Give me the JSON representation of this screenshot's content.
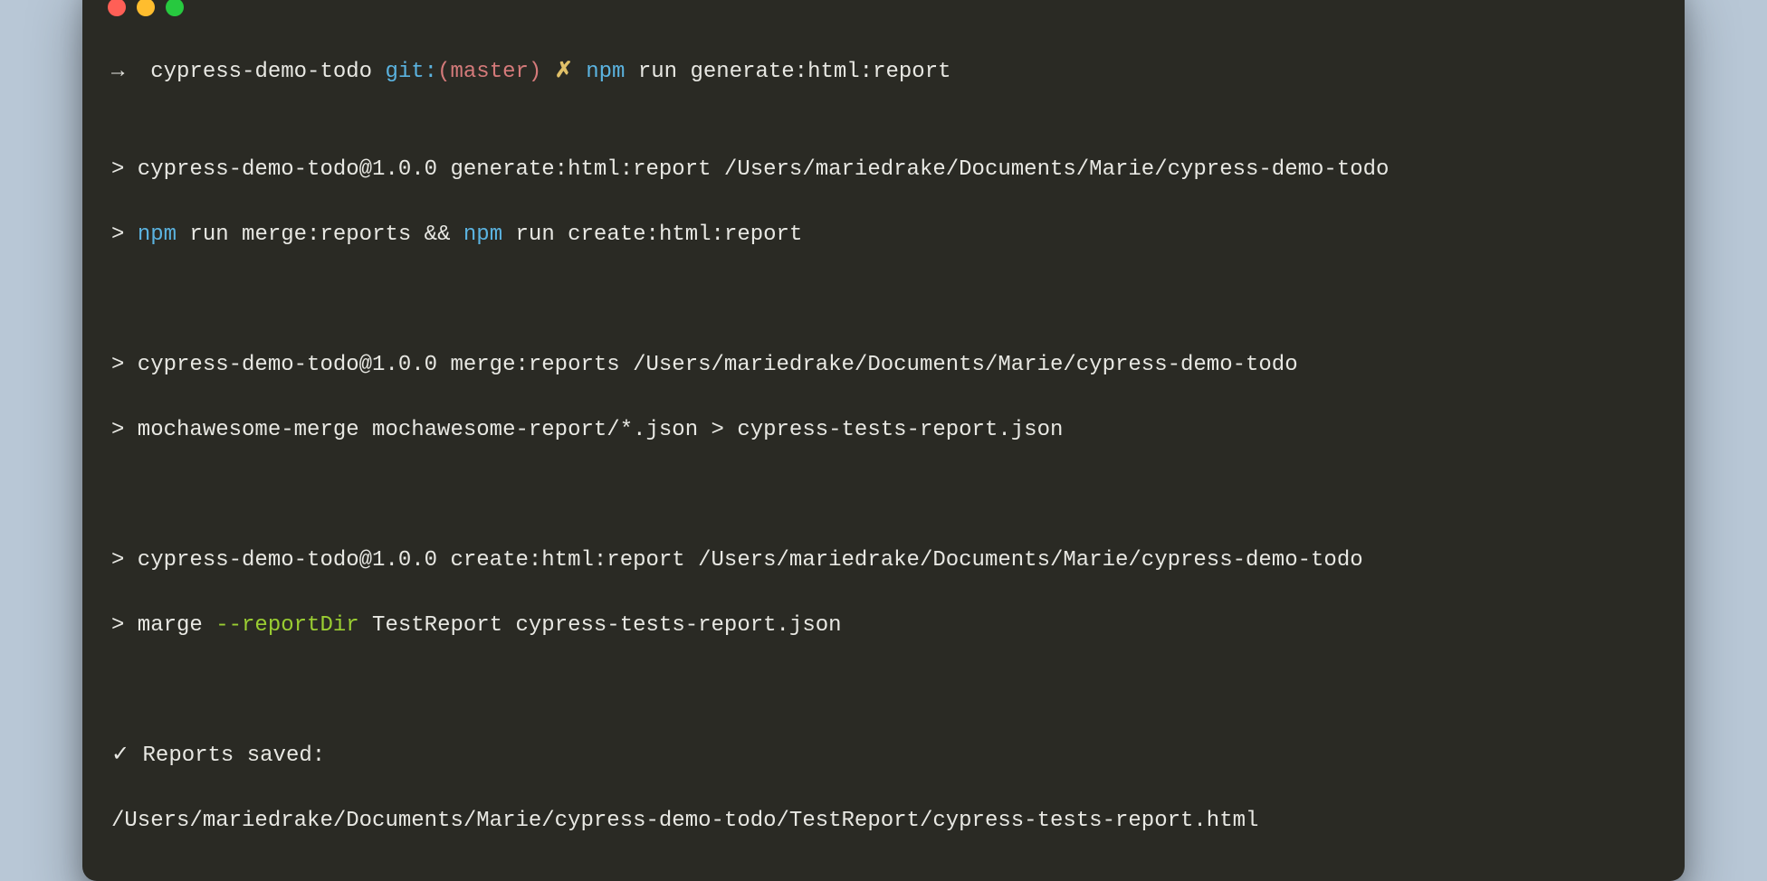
{
  "prompt": {
    "arrow": "→  ",
    "directory": "cypress-demo-todo ",
    "git_label": "git:",
    "git_branch": "(master) ",
    "dirty_marker": "✗",
    "space": " ",
    "command_npm": "npm",
    "command_rest": " run generate:html:report"
  },
  "block1": {
    "line1": "> cypress-demo-todo@1.0.0 generate:html:report /Users/mariedrake/Documents/Marie/cypress-demo-todo",
    "line2_prefix": "> ",
    "line2_npm1": "npm",
    "line2_mid1": " run merge:reports && ",
    "line2_npm2": "npm",
    "line2_rest": " run create:html:report"
  },
  "block2": {
    "line1": "> cypress-demo-todo@1.0.0 merge:reports /Users/mariedrake/Documents/Marie/cypress-demo-todo",
    "line2": "> mochawesome-merge mochawesome-report/*.json > cypress-tests-report.json"
  },
  "block3": {
    "line1": "> cypress-demo-todo@1.0.0 create:html:report /Users/mariedrake/Documents/Marie/cypress-demo-todo",
    "line2_prefix": "> marge ",
    "line2_flag": "--reportDir",
    "line2_rest": " TestReport cypress-tests-report.json"
  },
  "result": {
    "line1": "✓ Reports saved:",
    "line2": "/Users/mariedrake/Documents/Marie/cypress-demo-todo/TestReport/cypress-tests-report.html"
  }
}
